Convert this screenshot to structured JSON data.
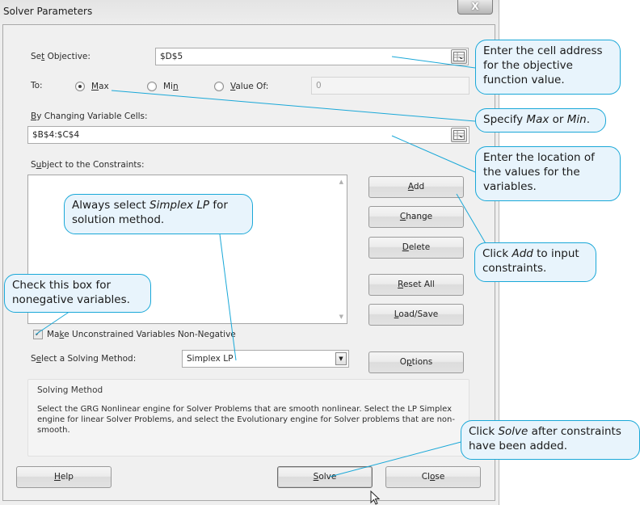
{
  "window": {
    "title": "Solver Parameters",
    "close_label": "X"
  },
  "objective": {
    "label_pre": "Se",
    "label_ul": "t",
    "label_post": " Objective:",
    "value": "$D$5"
  },
  "to": {
    "label": "To:",
    "options": [
      {
        "pre": "",
        "ul": "M",
        "post": "ax",
        "checked": true
      },
      {
        "pre": "Mi",
        "ul": "n",
        "post": "",
        "checked": false
      },
      {
        "pre": "",
        "ul": "V",
        "post": "alue Of:",
        "checked": false
      }
    ],
    "value_of": "0"
  },
  "changing_cells": {
    "label_ul": "B",
    "label_post": "y Changing Variable Cells:",
    "value": "$B$4:$C$4"
  },
  "constraints": {
    "label_pre": "S",
    "label_ul": "u",
    "label_post": "bject to the Constraints:",
    "items": []
  },
  "buttons": {
    "add": {
      "ul": "A",
      "post": "dd"
    },
    "change": {
      "ul": "C",
      "post": "hange"
    },
    "delete": {
      "ul": "D",
      "post": "elete"
    },
    "reset_all": {
      "ul": "R",
      "post": "eset All"
    },
    "load_save": {
      "ul": "L",
      "post": "oad/Save"
    },
    "options": {
      "pre": "O",
      "ul": "p",
      "post": "tions"
    },
    "help": {
      "ul": "H",
      "post": "elp"
    },
    "solve": {
      "ul": "S",
      "post": "olve"
    },
    "close": {
      "pre": "Cl",
      "ul": "o",
      "post": "se"
    }
  },
  "nonneg": {
    "checked": true,
    "check_glyph": "✓",
    "label_pre": "Ma",
    "label_ul": "k",
    "label_post": "e Unconstrained Variables Non-Negative"
  },
  "method": {
    "label_pre": "S",
    "label_ul": "e",
    "label_post": "lect a Solving Method:",
    "selected": "Simplex LP"
  },
  "solving_method": {
    "title": "Solving Method",
    "text": "Select the GRG Nonlinear engine for Solver Problems that are smooth nonlinear. Select the LP Simplex engine for linear Solver Problems, and select the Evolutionary engine for Solver problems that are non-smooth."
  },
  "callouts": {
    "objective": "Enter the cell address for the objective function value.",
    "maxmin": {
      "pre": "Specify ",
      "i1": "Max",
      "mid": " or ",
      "i2": "Min",
      "post": "."
    },
    "variables": "Enter the location of the values for the variables.",
    "simplex": {
      "pre": "Always select ",
      "i": "Simplex LP",
      "post": " for solution method."
    },
    "nonneg": "Check this box for nonegative variables.",
    "add": {
      "pre": "Click ",
      "i": "Add",
      "post": " to input constraints."
    },
    "solve": {
      "pre": "Click ",
      "i": "Solve",
      "post": " after constraints have been added."
    }
  },
  "colors": {
    "callout_border": "#1aa8d8",
    "callout_fill": "#e8f4fc",
    "dialog_bg": "#f0f0f0"
  }
}
